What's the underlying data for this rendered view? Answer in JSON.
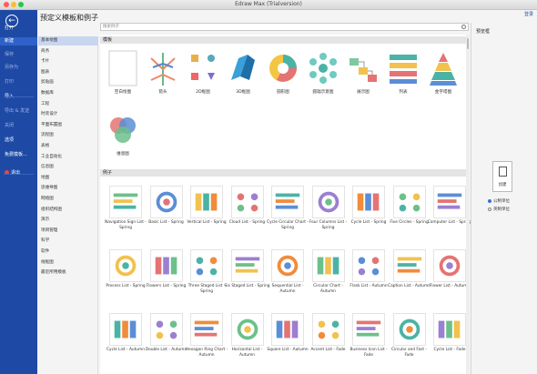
{
  "window": {
    "title": "Edraw Max (Trialversion)"
  },
  "header": {
    "help": "登录"
  },
  "leftnav": {
    "items": [
      {
        "label": "打开",
        "style": "normal"
      },
      {
        "label": "新建",
        "style": "active"
      },
      {
        "label": "保存",
        "style": "dim"
      },
      {
        "label": "另存为",
        "style": "dim"
      },
      {
        "label": "打印",
        "style": "dim"
      },
      {
        "label": "导入",
        "style": "normal"
      },
      {
        "label": "导出 & 发送",
        "style": "dim"
      },
      {
        "label": "关闭",
        "style": "dim"
      },
      {
        "label": "选项",
        "style": "normal"
      },
      {
        "label": "免费模板...",
        "style": "normal"
      },
      {
        "label": "退出",
        "style": "normal"
      }
    ]
  },
  "page": {
    "heading": "预定义模板和例子"
  },
  "search": {
    "placeholder": "搜索例子"
  },
  "categories": [
    "基本绘图",
    "商务",
    "卡片",
    "图表",
    "剪贴画",
    "数据库",
    "工程",
    "时装设计",
    "平面布置图",
    "流程图",
    "表格",
    "工业自动化",
    "信息图",
    "地图",
    "思维导图",
    "网络图",
    "组织结构图",
    "演示",
    "项目管理",
    "科学",
    "软件",
    "线框图",
    "最近所用模板"
  ],
  "sections": {
    "basic": "模板",
    "examples": "例子"
  },
  "basic_templates": [
    {
      "label": "空白绘图",
      "icon": "blank-page-icon"
    },
    {
      "label": "箭头",
      "icon": "arrows-icon"
    },
    {
      "label": "2D框图",
      "icon": "block-2d-icon"
    },
    {
      "label": "3D框图",
      "icon": "block-3d-icon"
    },
    {
      "label": "圆形图",
      "icon": "circle-chart-icon"
    },
    {
      "label": "圆辐示意图",
      "icon": "radial-diagram-icon"
    },
    {
      "label": "展示图",
      "icon": "showcase-icon"
    },
    {
      "label": "列表",
      "icon": "list-icon"
    },
    {
      "label": "金字塔图",
      "icon": "pyramid-icon"
    },
    {
      "label": "维恩图",
      "icon": "venn-icon"
    }
  ],
  "examples": [
    "Navigation Sign List - Spring",
    "Basic List - Spring",
    "Vertical List - Spring",
    "Cloud List - Spring",
    "Cycle Circular Chart - Spring",
    "Four Columns List - Spring",
    "Cycle List - Spring",
    "Five Circles - Spring",
    "Computer List - Spring",
    "Process List - Spring",
    "Flowers List - Spring",
    "Three Staged List - Spring",
    "Six Staged List - Spring",
    "Sequential List - Autumn",
    "Circular Chart - Autumn",
    "Flask List - Autumn",
    "Caption List - Autumn",
    "Flower List - Autumn",
    "Cycle List - Autumn",
    "Double List - Autumn",
    "Hexagon Ring Chart - Autumn",
    "Horizontal List - Autumn",
    "Square List - Autumn",
    "Accent List - Fade",
    "Business Icon List - Fade",
    "Circular and Fast - Fade",
    "Cycle List - Fade"
  ],
  "preview": {
    "title": "预览框",
    "create": "创建",
    "units": [
      {
        "label": "公制单位",
        "selected": true
      },
      {
        "label": "英制单位",
        "selected": false
      }
    ]
  },
  "colors": {
    "nav": "#1e4aa6",
    "nav_active": "#2f62c9",
    "selected_category": "#c9d6ef"
  }
}
